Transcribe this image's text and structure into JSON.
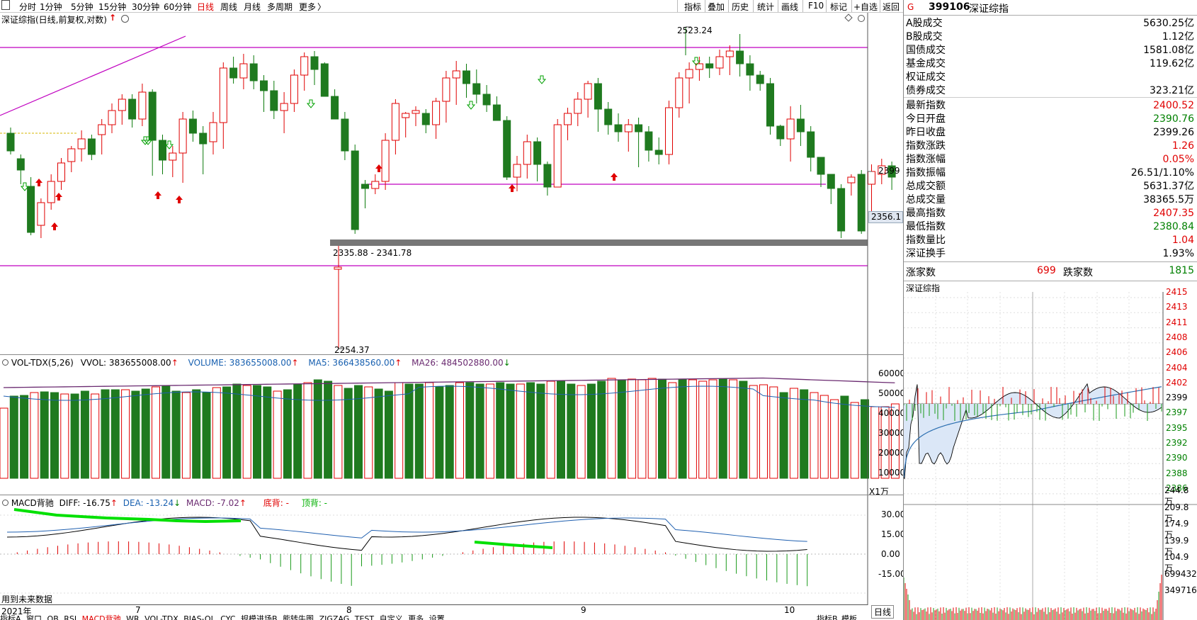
{
  "toolbar": {
    "menu_icon": "menu-icon",
    "periods": [
      "分时",
      "1分钟",
      "5分钟",
      "15分钟",
      "30分钟",
      "60分钟",
      "日线",
      "周线",
      "月线",
      "多周期",
      "更多"
    ],
    "active_period": "日线",
    "more_arrow": "〉",
    "right_buttons": [
      "指标",
      "叠加",
      "历史",
      "统计",
      "画线",
      "F10",
      "标记",
      "+自选",
      "返回"
    ]
  },
  "main_chart": {
    "title": "深证综指(日线,前复权,对数)",
    "title_arrow": "↑",
    "level_2399": "2399",
    "price_tag": "2356.1",
    "high_label": "2523.24",
    "low_label": "2254.37",
    "range_label": "2335.88 - 2341.78"
  },
  "chart_data": {
    "type": "candlestick",
    "yscale": "log",
    "x_axis": [
      "2021年",
      "7",
      "8",
      "9",
      "10"
    ],
    "high": 2523.24,
    "low": 2254.37,
    "last": 2399.26,
    "annotations": [
      "2523.24",
      "2254.37",
      "2335.88 - 2341.78"
    ]
  },
  "vol": {
    "name": "VOL-TDX(5,26)",
    "vvol": "VVOL: 383655008.00",
    "volume": "VOLUME: 383655008.00",
    "ma5": "MA5: 366438560.00",
    "ma26": "MA26: 484502880.00",
    "axis": [
      "60000",
      "50000",
      "40000",
      "30000",
      "20000",
      "10000"
    ],
    "unit": "X1万",
    "arrows": {
      "vvol": "↑",
      "volume": "↑",
      "ma5": "↑",
      "ma26": "↓"
    }
  },
  "macd": {
    "name": "MACD背驰",
    "diff": "DIFF: -16.75",
    "dea": "DEA: -13.24",
    "macd": "MACD: -7.02",
    "bottom": "底背: -",
    "top": "顶背: -",
    "axis": [
      "30.00",
      "15.00",
      "0.00",
      "-15.00"
    ],
    "arrows": {
      "diff": "↑",
      "dea": "↓",
      "macd": "↑"
    }
  },
  "future_data": "用到未来数据",
  "bottom_tabs": [
    "指标A",
    "窗口",
    "OB",
    "RSI",
    "MACD背驰",
    "WR",
    "VOL-TDX",
    "BIAS-QL",
    "CYC",
    "规模进场B",
    "熊转牛图",
    "ZIGZAG",
    "TEST",
    "自定义",
    "更多",
    "设置"
  ],
  "bottom_right": [
    "日线",
    "指标B",
    "模板"
  ],
  "quote": {
    "flag": "G",
    "code": "399106",
    "name": "深证综指",
    "rows": [
      {
        "l": "A股成交",
        "v": "5630.25亿",
        "c": ""
      },
      {
        "l": "B股成交",
        "v": "1.12亿",
        "c": ""
      },
      {
        "l": "国债成交",
        "v": "1581.08亿",
        "c": ""
      },
      {
        "l": "基金成交",
        "v": "119.62亿",
        "c": ""
      },
      {
        "l": "权证成交",
        "v": "",
        "c": ""
      },
      {
        "l": "债券成交",
        "v": "323.21亿",
        "c": ""
      },
      {
        "l": "最新指数",
        "v": "2400.52",
        "c": "red"
      },
      {
        "l": "今日开盘",
        "v": "2390.76",
        "c": "green"
      },
      {
        "l": "昨日收盘",
        "v": "2399.26",
        "c": ""
      },
      {
        "l": "指数涨跌",
        "v": "1.26",
        "c": "red"
      },
      {
        "l": "指数涨幅",
        "v": "0.05%",
        "c": "red"
      },
      {
        "l": "指数振幅",
        "v": "26.51/1.10%",
        "c": ""
      },
      {
        "l": "总成交额",
        "v": "5631.37亿",
        "c": ""
      },
      {
        "l": "总成交量",
        "v": "38365.5万",
        "c": ""
      },
      {
        "l": "最高指数",
        "v": "2407.35",
        "c": "red"
      },
      {
        "l": "最低指数",
        "v": "2380.84",
        "c": "green"
      },
      {
        "l": "指数量比",
        "v": "1.04",
        "c": "red"
      },
      {
        "l": "深证换手",
        "v": "1.93%",
        "c": ""
      }
    ],
    "up_label": "涨家数",
    "up": "699",
    "down_label": "跌家数",
    "down": "1815"
  },
  "intraday": {
    "title": "深证综指",
    "price_axis": [
      "2415",
      "2413",
      "2411",
      "2408",
      "2406",
      "2404",
      "2402",
      "2399",
      "2397",
      "2395",
      "2392",
      "2390",
      "2388",
      "2386"
    ],
    "vol_axis": [
      "244.8万",
      "209.8万",
      "174.9万",
      "139.9万",
      "104.9万",
      "699432",
      "349716"
    ]
  }
}
